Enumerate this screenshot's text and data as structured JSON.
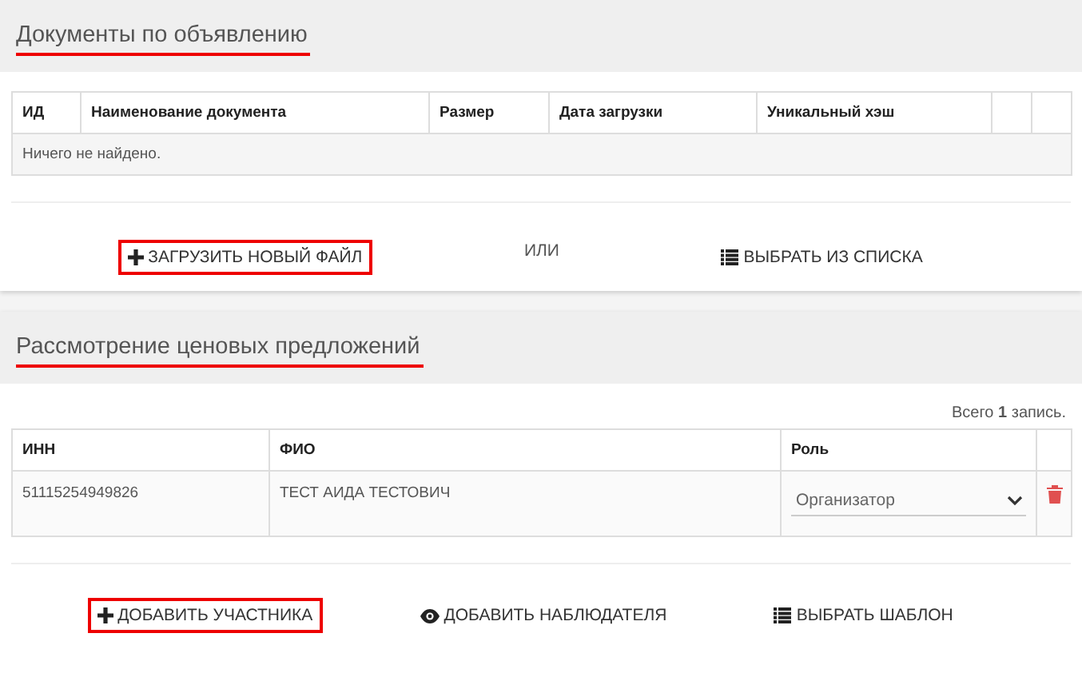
{
  "sections": [
    {
      "title": "Документы по объявлению",
      "underlined": true,
      "table": {
        "columns": [
          "ИД",
          "Наименование документа",
          "Размер",
          "Дата загрузки",
          "Уникальный хэш",
          "",
          ""
        ],
        "empty_text": "Ничего не найдено."
      },
      "actions": [
        {
          "kind": "plus",
          "label": "ЗАГРУЗИТЬ НОВЫЙ ФАЙЛ",
          "highlighted": true
        },
        {
          "kind": "text",
          "label": "ИЛИ",
          "highlighted": false
        },
        {
          "kind": "list",
          "label": "ВЫБРАТЬ ИЗ СПИСКА",
          "highlighted": false
        }
      ]
    },
    {
      "title": "Рассмотрение ценовых предложений",
      "underlined": true,
      "summary": "Всего **1** запись.",
      "table": {
        "columns": [
          "ИНН",
          "ФИО",
          "Роль",
          ""
        ],
        "rows": [
          {
            "inn": "51115254949826",
            "name": "ТЕСТ АИДА ТЕСТОВИЧ",
            "role": "Организатор"
          }
        ]
      },
      "actions": [
        {
          "kind": "plus",
          "label": "ДОБАВИТЬ УЧАСТНИКА",
          "highlighted": true
        },
        {
          "kind": "eye",
          "label": "ДОБАВИТЬ НАБЛЮДАТЕЛЯ",
          "highlighted": false
        },
        {
          "kind": "list",
          "label": "ВЫБРАТЬ ШАБЛОН",
          "highlighted": false
        }
      ]
    }
  ]
}
